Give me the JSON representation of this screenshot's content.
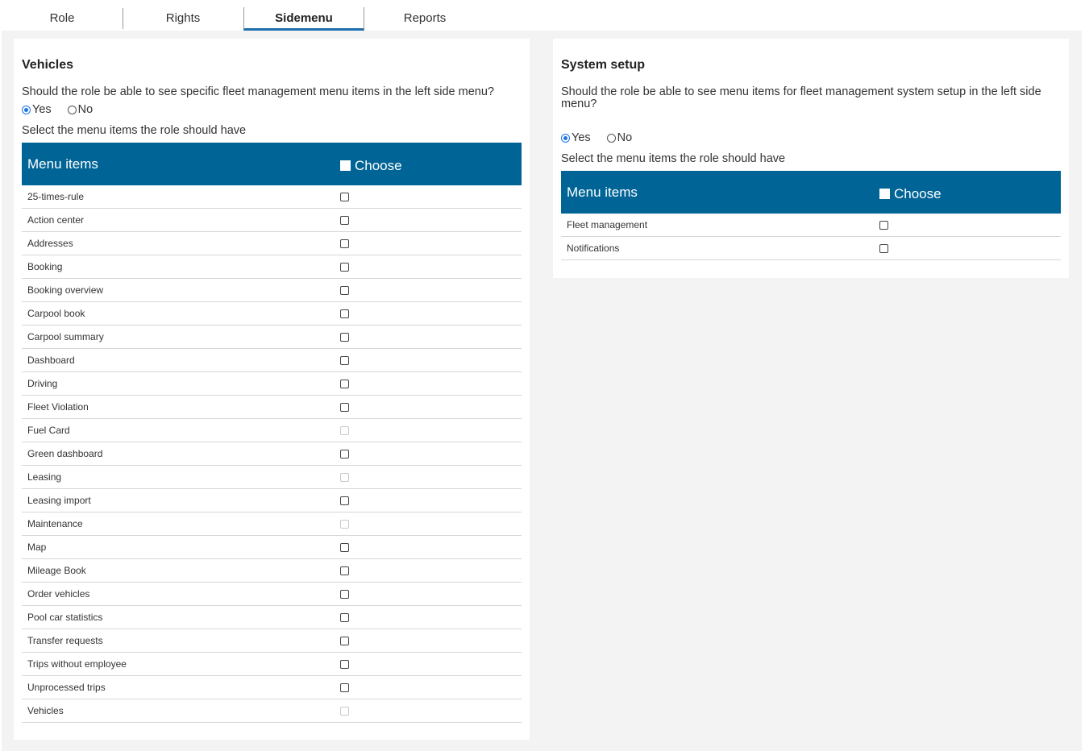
{
  "tabs": [
    {
      "label": "Role",
      "active": false
    },
    {
      "label": "Rights",
      "active": false
    },
    {
      "label": "Sidemenu",
      "active": true
    },
    {
      "label": "Reports",
      "active": false
    }
  ],
  "colors": {
    "header_bg": "#006496",
    "active_tab_underline": "#1f6fae",
    "content_bg": "#f3f3f3",
    "radio_accent": "#1a73e8"
  },
  "vehicles": {
    "title": "Vehicles",
    "question": "Should the role be able to see specific fleet management menu items in the left side menu?",
    "yes_label": "Yes",
    "no_label": "No",
    "selected": "Yes",
    "select_text": "Select the menu items the role should have",
    "col_menu_items": "Menu items",
    "col_choose": "Choose",
    "items": [
      {
        "label": "25-times-rule",
        "checked": false,
        "disabled": false
      },
      {
        "label": "Action center",
        "checked": false,
        "disabled": false
      },
      {
        "label": "Addresses",
        "checked": false,
        "disabled": false
      },
      {
        "label": "Booking",
        "checked": false,
        "disabled": false
      },
      {
        "label": "Booking overview",
        "checked": false,
        "disabled": false
      },
      {
        "label": "Carpool book",
        "checked": false,
        "disabled": false
      },
      {
        "label": "Carpool summary",
        "checked": false,
        "disabled": false
      },
      {
        "label": "Dashboard",
        "checked": false,
        "disabled": false
      },
      {
        "label": "Driving",
        "checked": false,
        "disabled": false
      },
      {
        "label": "Fleet Violation",
        "checked": false,
        "disabled": false
      },
      {
        "label": "Fuel Card",
        "checked": false,
        "disabled": true
      },
      {
        "label": "Green dashboard",
        "checked": false,
        "disabled": false
      },
      {
        "label": "Leasing",
        "checked": false,
        "disabled": true
      },
      {
        "label": "Leasing import",
        "checked": false,
        "disabled": false
      },
      {
        "label": "Maintenance",
        "checked": false,
        "disabled": true
      },
      {
        "label": "Map",
        "checked": false,
        "disabled": false
      },
      {
        "label": "Mileage Book",
        "checked": false,
        "disabled": false
      },
      {
        "label": "Order vehicles",
        "checked": false,
        "disabled": false
      },
      {
        "label": "Pool car statistics",
        "checked": false,
        "disabled": false
      },
      {
        "label": "Transfer requests",
        "checked": false,
        "disabled": false
      },
      {
        "label": "Trips without employee",
        "checked": false,
        "disabled": false
      },
      {
        "label": "Unprocessed trips",
        "checked": false,
        "disabled": false
      },
      {
        "label": "Vehicles",
        "checked": false,
        "disabled": true
      }
    ]
  },
  "system_setup": {
    "title": "System setup",
    "question": "Should the role be able to see menu items for fleet management system setup in the left side menu?",
    "yes_label": "Yes",
    "no_label": "No",
    "selected": "Yes",
    "select_text": "Select the menu items the role should have",
    "col_menu_items": "Menu items",
    "col_choose": "Choose",
    "items": [
      {
        "label": "Fleet management",
        "checked": false,
        "disabled": false
      },
      {
        "label": "Notifications",
        "checked": false,
        "disabled": false
      }
    ]
  }
}
